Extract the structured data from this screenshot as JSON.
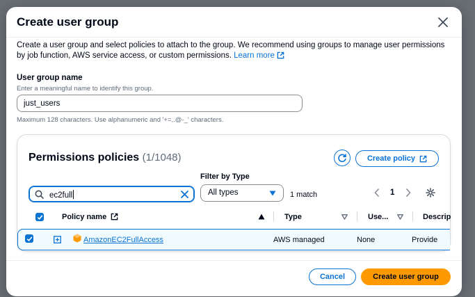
{
  "modal": {
    "title": "Create user group",
    "description": "Create a user group and select policies to attach to the group. We recommend using groups to manage user permissions by job function, AWS service access, or custom permissions.",
    "learn_more": "Learn more"
  },
  "group_name": {
    "label": "User group name",
    "description": "Enter a meaningful name to identify this group.",
    "value": "just_users",
    "constraint": "Maximum 128 characters. Use alphanumeric and '+=,.@-_' characters."
  },
  "policies": {
    "title": "Permissions policies",
    "count": "(1/1048)",
    "create_policy_label": "Create policy",
    "search_value": "ec2full",
    "filter_label": "Filter by Type",
    "filter_value": "All types",
    "match_text": "1 match",
    "page_number": "1",
    "columns": {
      "policy_name": "Policy name",
      "type": "Type",
      "used_as": "Use...",
      "description": "Descrip"
    },
    "rows": [
      {
        "policy_name": "AmazonEC2FullAccess",
        "type": "AWS managed",
        "used_as": "None",
        "description": "Provide"
      }
    ]
  },
  "footer": {
    "cancel_label": "Cancel",
    "create_label": "Create user group"
  },
  "colors": {
    "accent": "#0972d3",
    "primary_button": "#ff9900",
    "policy_icon": "#ff9900"
  }
}
